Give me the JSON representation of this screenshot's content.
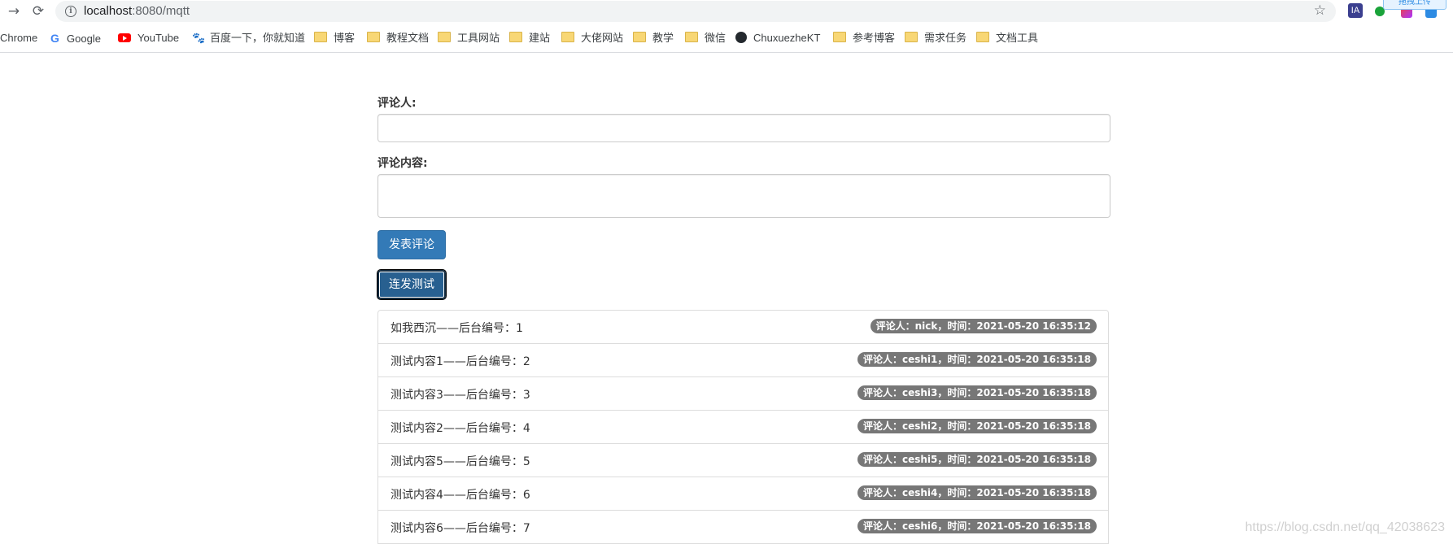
{
  "browser": {
    "url_host": "localhost",
    "url_path": ":8080/mqtt",
    "ext_label_ia": "IA",
    "upload_label": "拖拽上传"
  },
  "bookmarks": [
    {
      "label": "Chrome",
      "icon": "none"
    },
    {
      "label": "Google",
      "icon": "google-icon"
    },
    {
      "label": "YouTube",
      "icon": "youtube-icon"
    },
    {
      "label": "百度一下，你就知道",
      "icon": "baidu-icon"
    },
    {
      "label": "博客",
      "icon": "folder-icon"
    },
    {
      "label": "教程文档",
      "icon": "folder-icon"
    },
    {
      "label": "工具网站",
      "icon": "folder-icon"
    },
    {
      "label": "建站",
      "icon": "folder-icon"
    },
    {
      "label": "大佬网站",
      "icon": "folder-icon"
    },
    {
      "label": "教学",
      "icon": "folder-icon"
    },
    {
      "label": "微信",
      "icon": "folder-icon"
    },
    {
      "label": "ChuxuezheKT",
      "icon": "github-icon"
    },
    {
      "label": "参考博客",
      "icon": "folder-icon"
    },
    {
      "label": "需求任务",
      "icon": "folder-icon"
    },
    {
      "label": "文档工具",
      "icon": "folder-icon"
    }
  ],
  "form": {
    "commenter_label": "评论人:",
    "commenter_value": "",
    "content_label": "评论内容:",
    "content_value": "",
    "submit_label": "发表评论",
    "burst_label": "连发测试"
  },
  "comments": [
    {
      "text": "如我西沉——后台编号：1",
      "meta": "评论人：nick，时间：2021-05-20 16:35:12"
    },
    {
      "text": "测试内容1——后台编号：2",
      "meta": "评论人：ceshi1，时间：2021-05-20 16:35:18"
    },
    {
      "text": "测试内容3——后台编号：3",
      "meta": "评论人：ceshi3，时间：2021-05-20 16:35:18"
    },
    {
      "text": "测试内容2——后台编号：4",
      "meta": "评论人：ceshi2，时间：2021-05-20 16:35:18"
    },
    {
      "text": "测试内容5——后台编号：5",
      "meta": "评论人：ceshi5，时间：2021-05-20 16:35:18"
    },
    {
      "text": "测试内容4——后台编号：6",
      "meta": "评论人：ceshi4，时间：2021-05-20 16:35:18"
    },
    {
      "text": "测试内容6——后台编号：7",
      "meta": "评论人：ceshi6，时间：2021-05-20 16:35:18"
    }
  ],
  "watermark": "https://blog.csdn.net/qq_42038623"
}
